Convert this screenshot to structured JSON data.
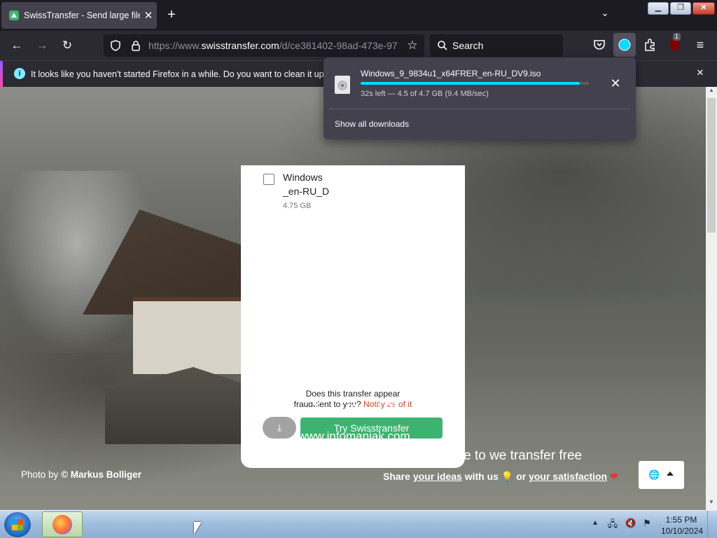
{
  "browser": {
    "tab": {
      "title": "SwissTransfer - Send large files",
      "favicon": "swisstransfer-icon"
    },
    "new_tab_label": "+",
    "url_prefix": "https://www.",
    "url_domain": "swisstransfer.com",
    "url_path": "/d/ce381402-98ad-473e-97",
    "search_placeholder": "Search",
    "ublock_badge": "1",
    "icons": [
      "back-icon",
      "forward-icon",
      "reload-icon",
      "shield-icon",
      "lock-icon",
      "star-icon",
      "search-icon",
      "pocket-icon",
      "download-icon",
      "extensions-icon",
      "ublock-icon",
      "menu-icon"
    ]
  },
  "notification": {
    "text": "It looks like you haven't started Firefox in a while. Do you want to clean it up for"
  },
  "downloads_panel": {
    "filename": "Windows_9_9834u1_x64FRER_en-RU_DV9.iso",
    "progress": 0.96,
    "status": "32s left — 4.5 of 4.7 GB (9.4 MB/sec)",
    "show_all": "Show all downloads"
  },
  "transfer": {
    "file_name_line1": "Windows",
    "file_name_line2": "_en-RU_D",
    "file_size": "4.75 GB",
    "fraud_line1": "Does this transfer appear",
    "fraud_line2_prefix": "fraudulent to you?",
    "fraud_link": "Notify us of it",
    "try_button": "Try Swisstransfer"
  },
  "footer": {
    "social_icons": [
      "facebook-icon",
      "x-icon",
      "linkedin-icon",
      "instagram-icon",
      "share-icon"
    ],
    "site": "www.infomaniak.com",
    "photo_by": "Photo by",
    "photo_credit": "© Markus Bolliger",
    "alt_title": "The alternative to we transfer free",
    "share_prefix": "Share",
    "share_ideas": "your ideas",
    "share_mid": "with us",
    "share_or": "or",
    "share_satisfaction": "your satisfaction"
  },
  "taskbar": {
    "time": "1:55 PM",
    "date": "10/10/2024"
  }
}
